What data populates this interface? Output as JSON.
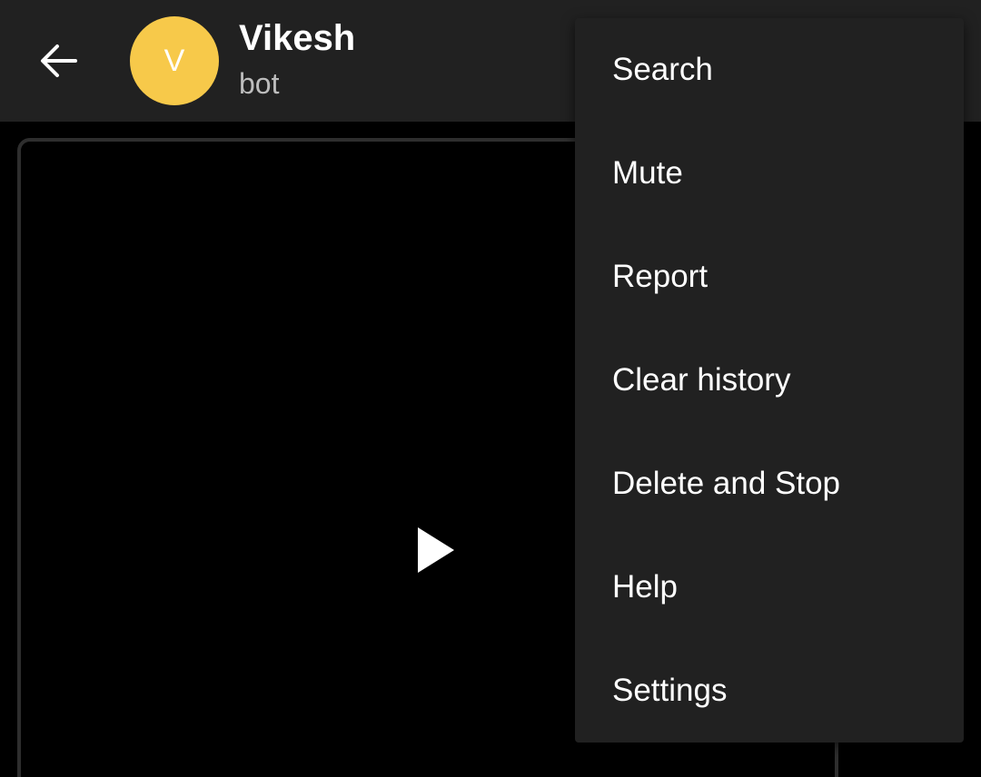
{
  "header": {
    "title": "Vikesh",
    "subtitle": "bot",
    "avatar_letter": "V",
    "avatar_color": "#f7c94a",
    "back_icon": "arrow-left-icon",
    "background": "#212121"
  },
  "video": {
    "play_icon": "play-icon"
  },
  "menu": {
    "background": "#212121",
    "items": [
      {
        "label": "Search"
      },
      {
        "label": "Mute"
      },
      {
        "label": "Report"
      },
      {
        "label": "Clear history"
      },
      {
        "label": "Delete and Stop"
      },
      {
        "label": "Help"
      },
      {
        "label": "Settings"
      }
    ]
  }
}
